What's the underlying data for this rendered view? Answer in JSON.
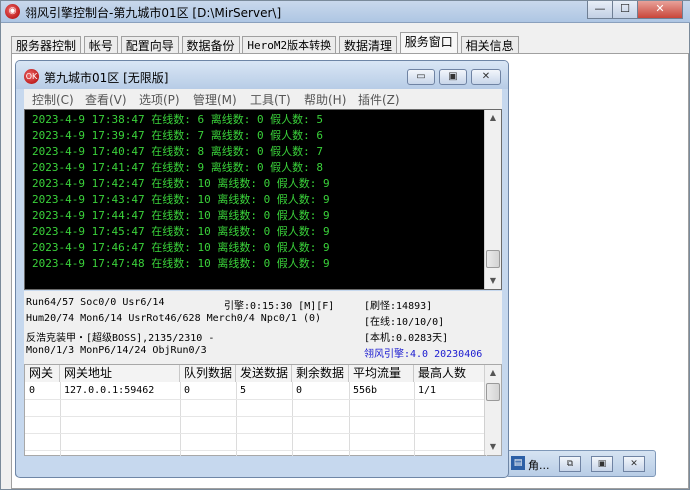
{
  "window": {
    "title": "翎风引擎控制台-第九城市01区 [D:\\MirServer\\]",
    "icon_name": "app-logo-icon",
    "buttons": {
      "minimize": "—",
      "maximize": "☐",
      "close": "✕"
    }
  },
  "tabs": [
    {
      "label": "服务器控制",
      "active": false
    },
    {
      "label": "帐号",
      "active": false
    },
    {
      "label": "配置向导",
      "active": false
    },
    {
      "label": "数据备份",
      "active": false
    },
    {
      "label": "HeroM2版本转换",
      "active": false
    },
    {
      "label": "数据清理",
      "active": false
    },
    {
      "label": "服务窗口",
      "active": true
    },
    {
      "label": "相关信息",
      "active": false
    }
  ],
  "inner_window": {
    "title": "第九城市01区 [无限版]",
    "icon_name": "ok-logo-icon",
    "icon_text": "OK",
    "buttons": {
      "minimize": "▭",
      "maximize": "▣",
      "close": "✕"
    },
    "menu": [
      "控制(C)",
      "查看(V)",
      "选项(P)",
      "管理(M)",
      "工具(T)",
      "帮助(H)",
      "插件(Z)"
    ],
    "log_lines": [
      "2023-4-9 17:38:47 在线数: 6 离线数: 0 假人数: 5",
      "2023-4-9 17:39:47 在线数: 7 离线数: 0 假人数: 6",
      "2023-4-9 17:40:47 在线数: 8 离线数: 0 假人数: 7",
      "2023-4-9 17:41:47 在线数: 9 离线数: 0 假人数: 8",
      "2023-4-9 17:42:47 在线数: 10 离线数: 0 假人数: 9",
      "2023-4-9 17:43:47 在线数: 10 离线数: 0 假人数: 9",
      "2023-4-9 17:44:47 在线数: 10 离线数: 0 假人数: 9",
      "2023-4-9 17:45:47 在线数: 10 离线数: 0 假人数: 9",
      "2023-4-9 17:46:47 在线数: 10 离线数: 0 假人数: 9",
      "2023-4-9 17:47:48 在线数: 10 离线数: 0 假人数: 9"
    ],
    "status": {
      "run": "Run64/57 Soc0/0 Usr6/14",
      "engine_time": "引擎:0:15:30 [M][F]",
      "refresh": "[刷怪:14893]",
      "hum": "Hum20/74 Mon6/14 UsrRot46/628 Merch0/4 Npc0/1 (0)",
      "online": "[在线:10/10/0]",
      "boss": "反浩克装甲・[超级BOSS],2135/2310 -",
      "local": "[本机:0.0283天]",
      "mon": "Mon0/1/3 MonP6/14/24 ObjRun0/3",
      "version": "翎风引擎:4.0 20230406"
    },
    "grid": {
      "headers": [
        "网关",
        "网关地址",
        "队列数据",
        "发送数据",
        "剩余数据",
        "平均流量",
        "最高人数"
      ],
      "rows": [
        [
          "0",
          "127.0.0.1:59462",
          "0",
          "5",
          "0",
          "556b",
          "1/1"
        ]
      ]
    }
  },
  "taskbar_item": {
    "label": "角...",
    "icon_name": "window-app-icon",
    "buttons": {
      "restore": "⧉",
      "maximize": "▣",
      "close": "✕"
    }
  },
  "colors": {
    "console_bg": "#000000",
    "console_text": "#3ad23a",
    "version_text": "#1a1ad0"
  }
}
